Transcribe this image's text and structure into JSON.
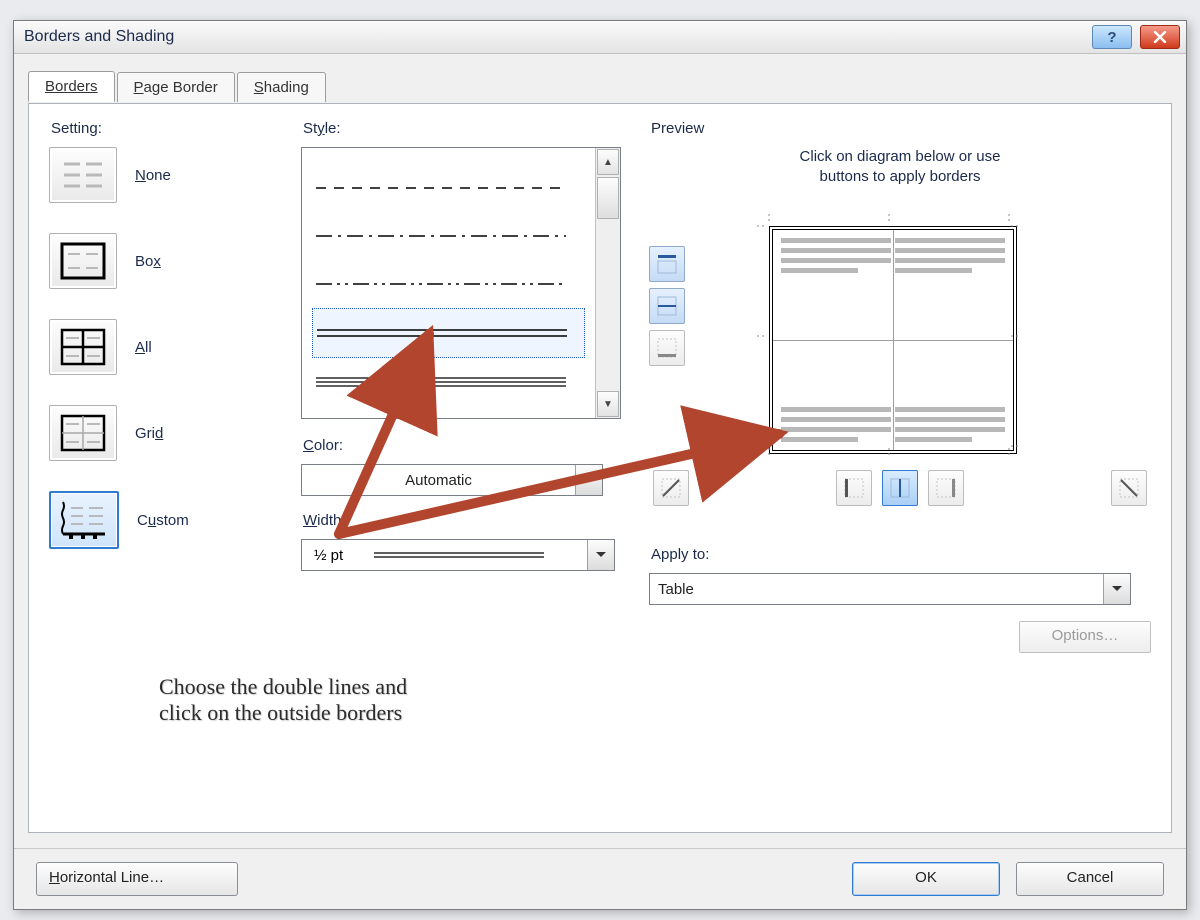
{
  "window": {
    "title": "Borders and Shading"
  },
  "tabs": {
    "borders": "Borders",
    "page_border": "Page Border",
    "shading": "Shading"
  },
  "settings": {
    "heading": "Setting:",
    "none": "None",
    "box": "Box",
    "all": "All",
    "grid": "Grid",
    "custom": "Custom"
  },
  "style": {
    "heading": "Style:",
    "color_heading": "Color:",
    "color_value": "Automatic",
    "width_heading": "Width:",
    "width_value": "½ pt"
  },
  "preview": {
    "heading": "Preview",
    "hint_line1": "Click on diagram below or use",
    "hint_line2": "buttons to apply borders",
    "apply_heading": "Apply to:",
    "apply_value": "Table",
    "options_label": "Options…"
  },
  "footer": {
    "horizontal_line": "Horizontal Line…",
    "ok": "OK",
    "cancel": "Cancel"
  },
  "annotation": {
    "line1": "Choose the double lines and",
    "line2": "click on the outside borders"
  }
}
